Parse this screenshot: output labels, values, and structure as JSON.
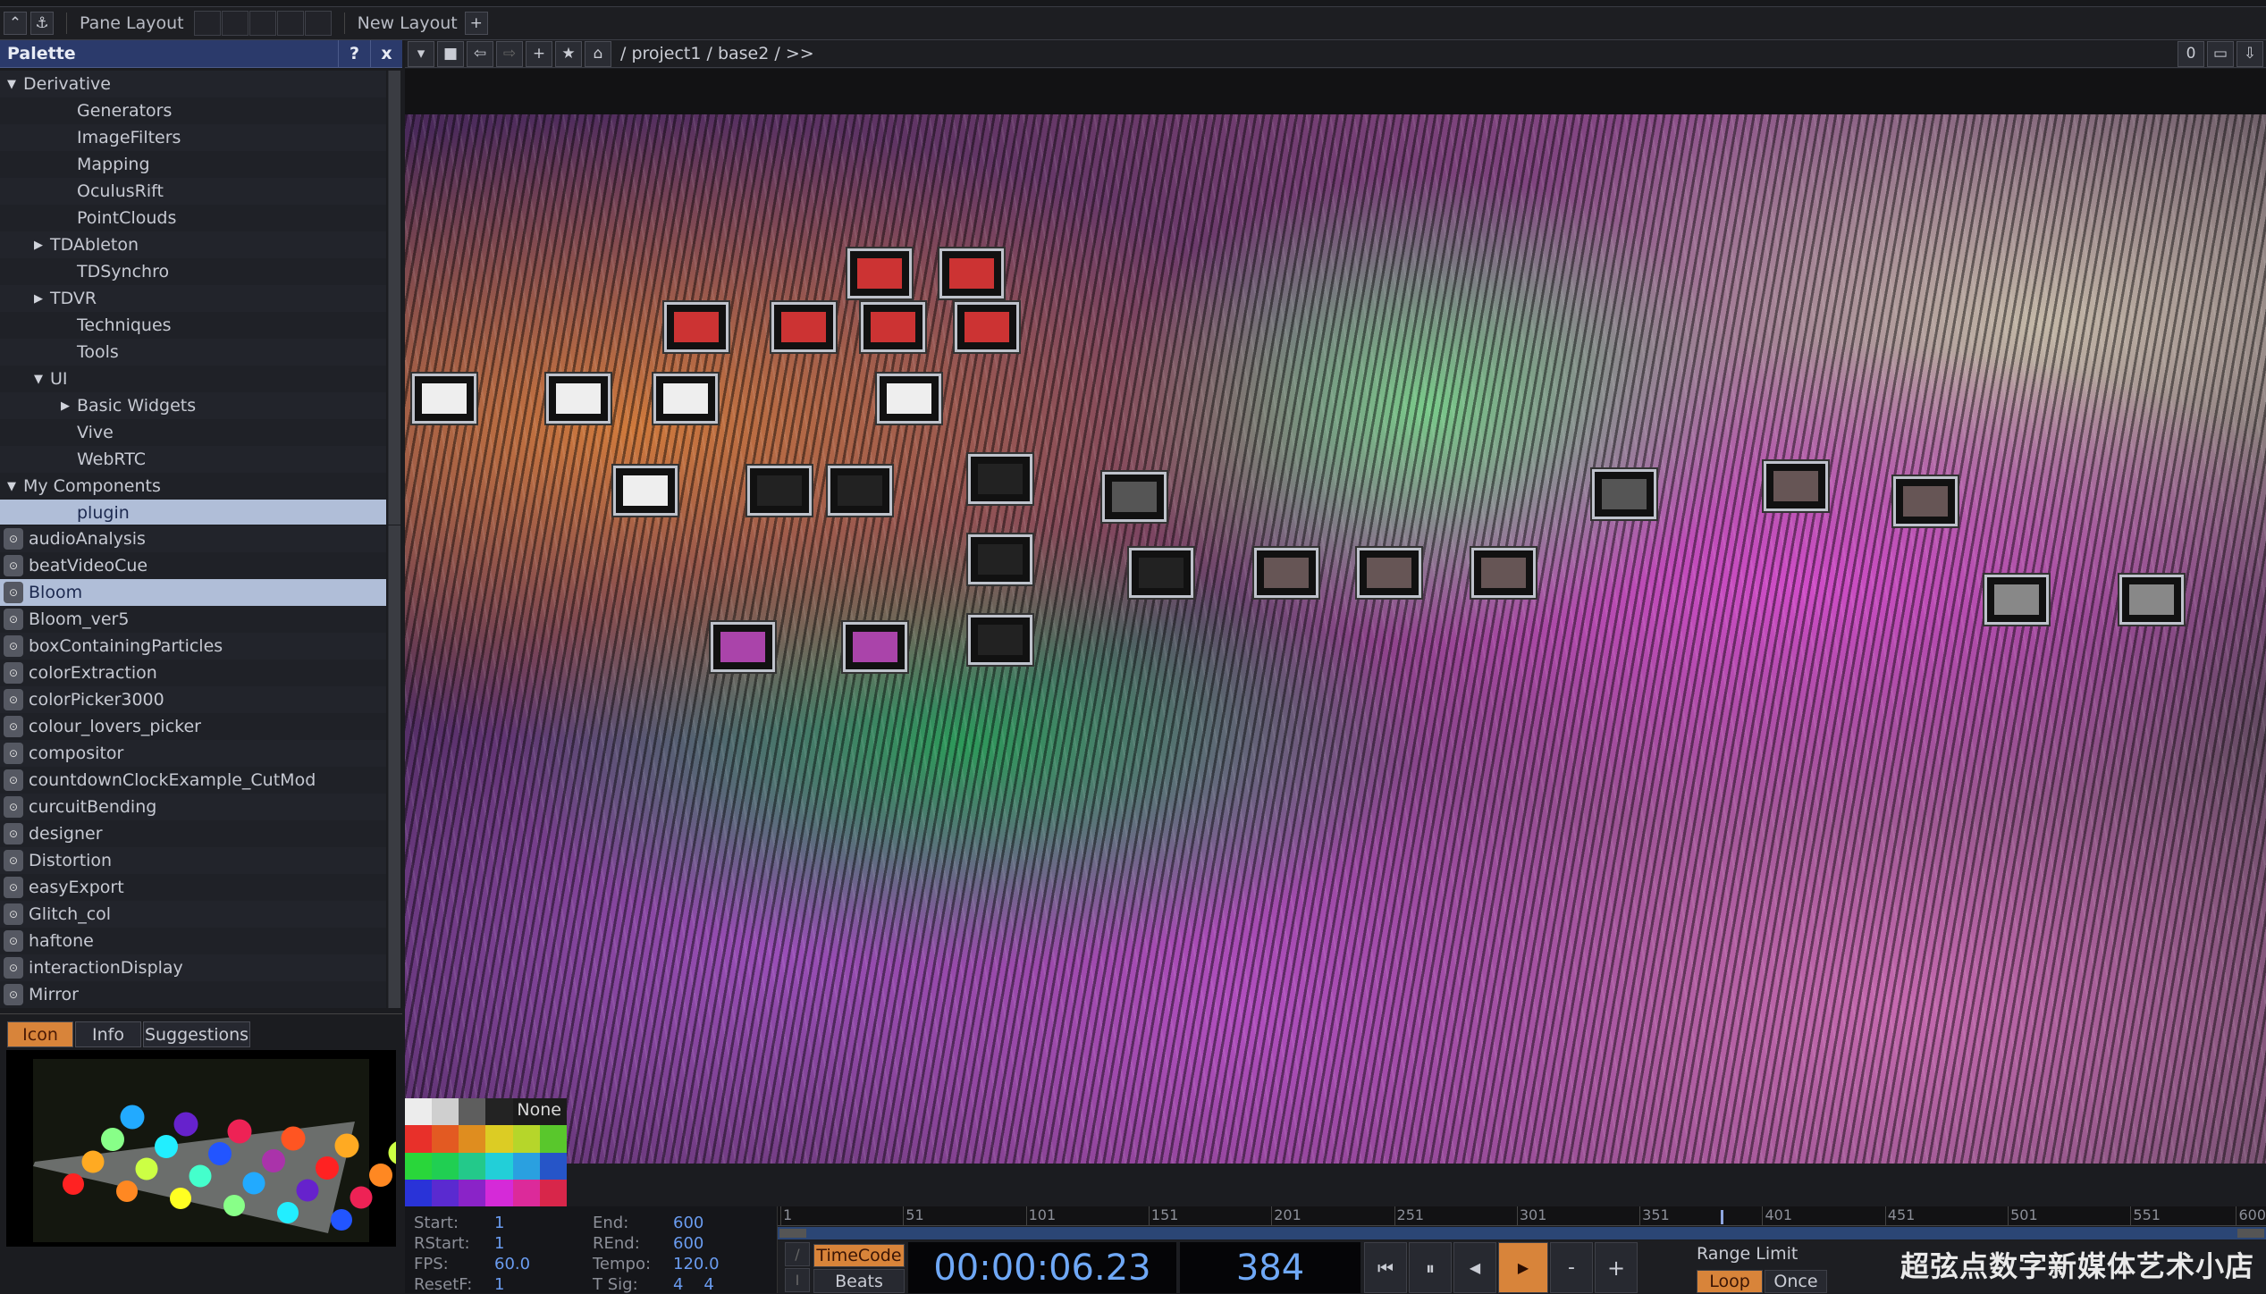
{
  "topbar": {
    "pane_layout": "Pane Layout",
    "new_layout": "New Layout",
    "add": "+"
  },
  "palette": {
    "title": "Palette",
    "help": "?",
    "close": "x",
    "tree": [
      {
        "label": "Derivative",
        "level": 0,
        "arrow": "down"
      },
      {
        "label": "Generators",
        "level": 2,
        "arrow": ""
      },
      {
        "label": "ImageFilters",
        "level": 2,
        "arrow": ""
      },
      {
        "label": "Mapping",
        "level": 2,
        "arrow": ""
      },
      {
        "label": "OculusRift",
        "level": 2,
        "arrow": ""
      },
      {
        "label": "PointClouds",
        "level": 2,
        "arrow": ""
      },
      {
        "label": "TDAbleton",
        "level": 1,
        "arrow": "right"
      },
      {
        "label": "TDSynchro",
        "level": 2,
        "arrow": ""
      },
      {
        "label": "TDVR",
        "level": 1,
        "arrow": "right"
      },
      {
        "label": "Techniques",
        "level": 2,
        "arrow": ""
      },
      {
        "label": "Tools",
        "level": 2,
        "arrow": ""
      },
      {
        "label": "UI",
        "level": 1,
        "arrow": "down"
      },
      {
        "label": "Basic Widgets",
        "level": 2,
        "arrow": "right"
      },
      {
        "label": "Vive",
        "level": 2,
        "arrow": ""
      },
      {
        "label": "WebRTC",
        "level": 2,
        "arrow": ""
      },
      {
        "label": "My Components",
        "level": 0,
        "arrow": "down"
      },
      {
        "label": "plugin",
        "level": 2,
        "arrow": "",
        "selected": true
      }
    ],
    "components": [
      "audioAnalysis",
      "beatVideoCue",
      "Bloom",
      "Bloom_ver5",
      "boxContainingParticles",
      "colorExtraction",
      "colorPicker3000",
      "colour_lovers_picker",
      "compositor",
      "countdownClockExample_CutMod",
      "curcuitBending",
      "designer",
      "Distortion",
      "easyExport",
      "Glitch_col",
      "haftone",
      "interactionDisplay",
      "Mirror"
    ],
    "selected_component": "Bloom",
    "tabs": [
      "Icon",
      "Info",
      "Suggestions"
    ],
    "active_tab": "Icon"
  },
  "network": {
    "path": "/ project1 / base2 / >>",
    "counter": "0"
  },
  "swatches": {
    "none_label": "None",
    "colors": [
      "#ececec",
      "#cfcfcf",
      "#5e5e5e",
      "#232323",
      "#1b1b1b",
      "#1b1b1b",
      "#e8302a",
      "#e35a22",
      "#df8d1f",
      "#dccc24",
      "#b6d62a",
      "#59c72c",
      "#29d63a",
      "#20cf52",
      "#23c98a",
      "#22cfd8",
      "#2aa0e0",
      "#2655c8",
      "#2933d8",
      "#5a2ad0",
      "#8a23c8",
      "#d52ad8",
      "#dc2a9a",
      "#d8264a"
    ]
  },
  "info": {
    "start_label": "Start:",
    "start": "1",
    "end_label": "End:",
    "end": "600",
    "rstart_label": "RStart:",
    "rstart": "1",
    "rend_label": "REnd:",
    "rend": "600",
    "fps_label": "FPS:",
    "fps": "60.0",
    "tempo_label": "Tempo:",
    "tempo": "120.0",
    "resetf_label": "ResetF:",
    "resetf": "1",
    "tsig_label": "T Sig:",
    "tsig": "4    4"
  },
  "timeline": {
    "ticks": [
      "1",
      "51",
      "101",
      "151",
      "201",
      "251",
      "301",
      "351",
      "401",
      "451",
      "501",
      "551",
      "600"
    ],
    "range": [
      1,
      600
    ],
    "current_frame": 384
  },
  "transport": {
    "timecode_label": "TimeCode",
    "beats_label": "Beats",
    "timecode": "00:00:06.23",
    "frame": "384",
    "rewind": "⏮",
    "pause": "⏸",
    "step_back": "◀",
    "play": "▶",
    "minus": "-",
    "plus": "+",
    "range_limit": "Range Limit",
    "loop": "Loop",
    "once": "Once",
    "accent": "#d8843a"
  },
  "watermark": "超弦点数字新媒体艺术小店"
}
